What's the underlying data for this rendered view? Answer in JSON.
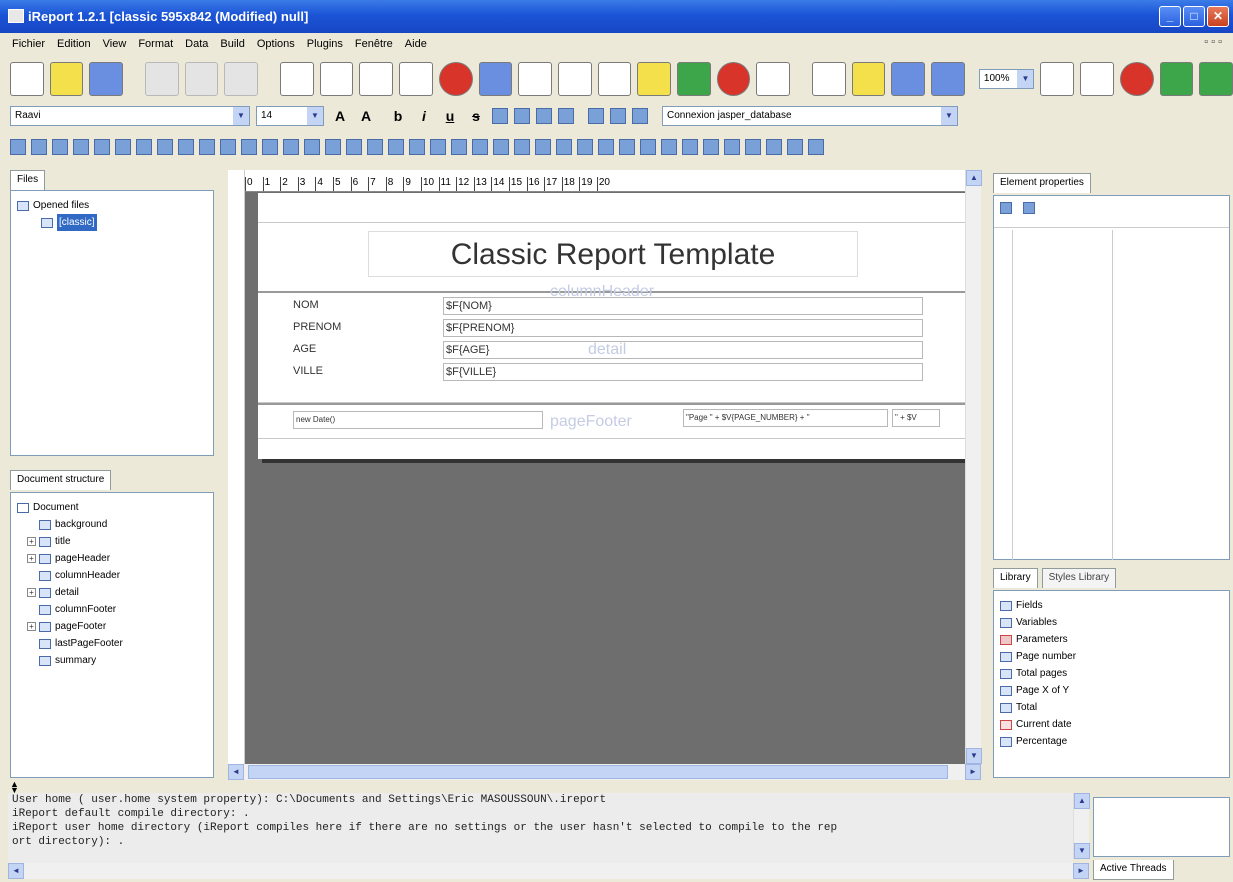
{
  "window": {
    "title": "iReport 1.2.1  [classic 595x842 (Modified) null]"
  },
  "menu": [
    "Fichier",
    "Edition",
    "View",
    "Format",
    "Data",
    "Build",
    "Options",
    "Plugins",
    "Fenêtre",
    "Aide"
  ],
  "toolbar": {
    "zoom": "100%",
    "font_name": "Raavi",
    "font_size": "14",
    "connection": "Connexion jasper_database"
  },
  "files_panel": {
    "tab": "Files",
    "root": "Opened files",
    "file": "[classic]"
  },
  "structure_panel": {
    "tab": "Document structure",
    "root": "Document",
    "items": [
      "background",
      "title",
      "pageHeader",
      "columnHeader",
      "detail",
      "columnFooter",
      "pageFooter",
      "lastPageFooter",
      "summary"
    ]
  },
  "ruler": [
    "0",
    "1",
    "2",
    "3",
    "4",
    "5",
    "6",
    "7",
    "8",
    "9",
    "10",
    "11",
    "12",
    "13",
    "14",
    "15",
    "16",
    "17",
    "18",
    "19",
    "20"
  ],
  "report": {
    "title": "Classic Report Template",
    "column_header_band": "columnHeader",
    "detail_band": "detail",
    "page_footer_band": "pageFooter",
    "rows": [
      {
        "label": "NOM",
        "field": "$F{NOM}"
      },
      {
        "label": "PRENOM",
        "field": "$F{PRENOM}"
      },
      {
        "label": "AGE",
        "field": "$F{AGE}"
      },
      {
        "label": "VILLE",
        "field": "$F{VILLE}"
      }
    ],
    "footer_date": "new Date()",
    "footer_page": "\"Page \" + $V{PAGE_NUMBER} + \"",
    "footer_page2": "\" + $V"
  },
  "properties_panel": {
    "tab": "Element properties"
  },
  "library": {
    "tab": "Library",
    "tab2": "Styles Library",
    "items": [
      "Fields",
      "Variables",
      "Parameters",
      "Page number",
      "Total pages",
      "Page X of Y",
      "Total",
      "Current date",
      "Percentage"
    ]
  },
  "console": {
    "lines": [
      "User home ( user.home system property): C:\\Documents and Settings\\Eric MASOUSSOUN\\.ireport",
      "iReport default compile directory: .",
      "iReport user home directory (iReport compiles here if there are no settings or the user hasn't selected to compile to the rep",
      "ort directory): ."
    ]
  },
  "threads": {
    "tab": "Active Threads"
  }
}
